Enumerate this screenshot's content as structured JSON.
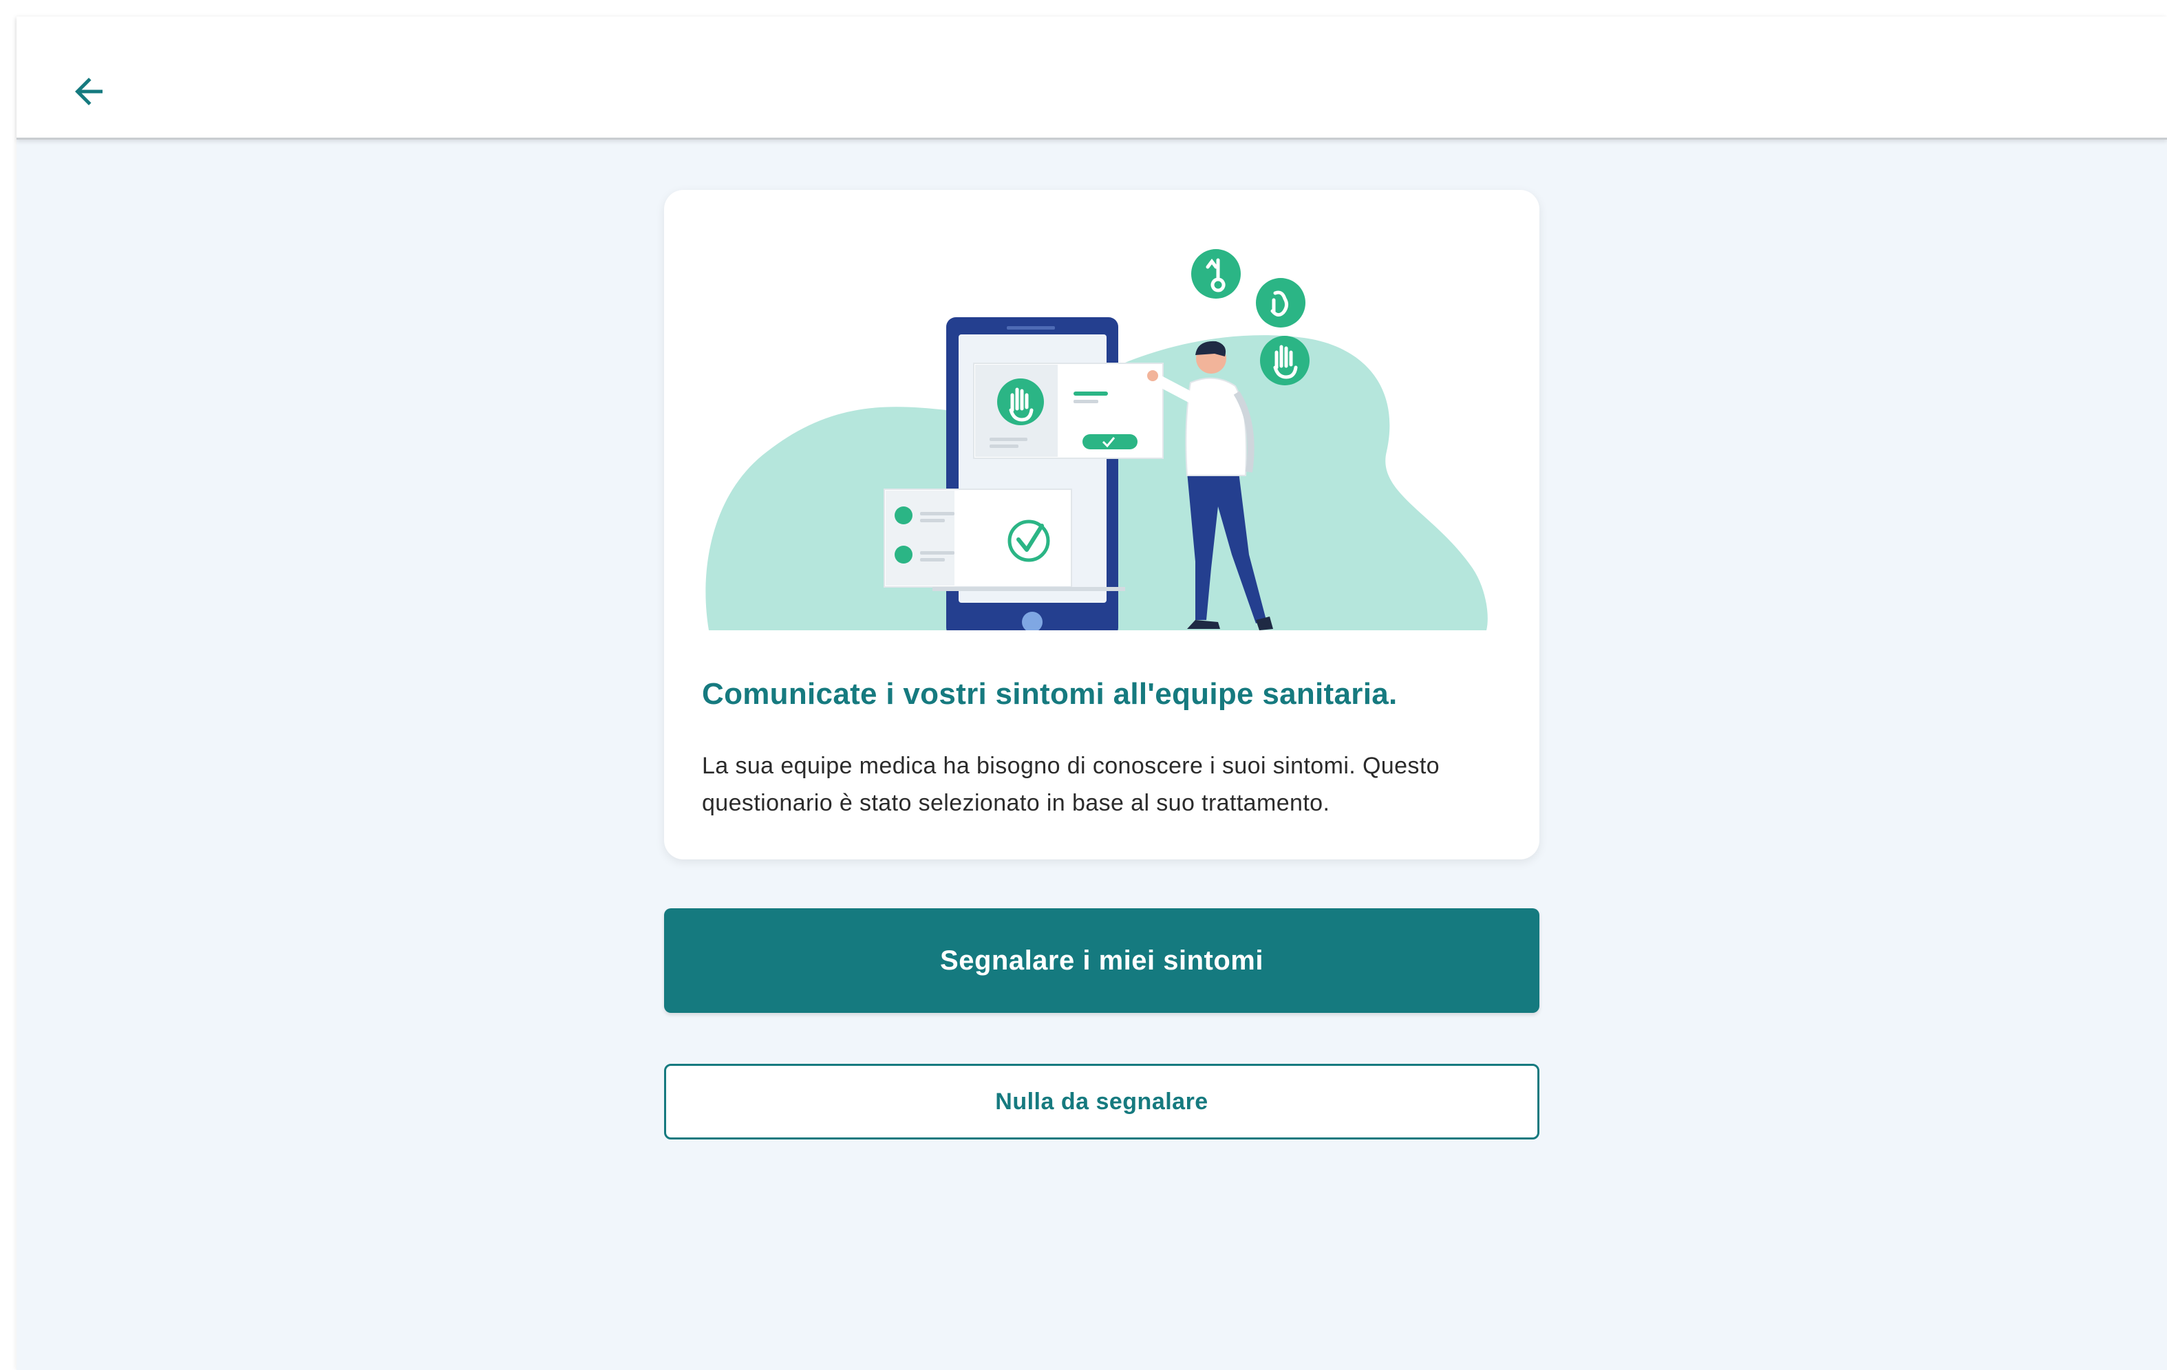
{
  "header": {
    "back_icon": "arrow-left-icon"
  },
  "card": {
    "illustration_icons": [
      "thermometer-icon",
      "hand-icon",
      "stop-hand-icon",
      "check-circle-icon"
    ],
    "title": "Comunicate i vostri sintomi all'equipe sanitaria.",
    "description": "La sua equipe medica ha bisogno di conoscere i suoi sintomi. Questo questionario è stato selezionato in base al suo trattamento."
  },
  "actions": {
    "report_label": "Segnalare i miei sintomi",
    "nothing_label": "Nulla da segnalare"
  },
  "colors": {
    "accent": "#157a7f",
    "background": "#f1f6fb",
    "illustration_mint": "#b5e6dc",
    "illustration_green": "#2bb585",
    "illustration_navy": "#243f8f"
  }
}
